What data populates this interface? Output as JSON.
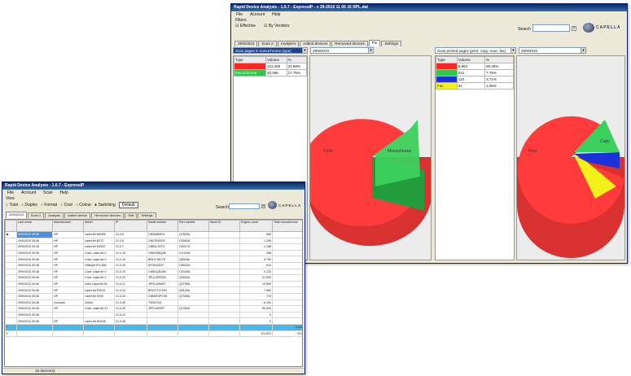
{
  "main_window": {
    "title": "Rapid Device Analysis - 1.0.7 - ExpressIP - v 29-2010 11 06 16 RPL.dat",
    "menu": [
      "File",
      "Account",
      "Help"
    ],
    "filter_label": "Filters",
    "checkboxes": [
      {
        "label": "Effective",
        "checked": true
      },
      {
        "label": "By Vendors",
        "checked": true
      }
    ],
    "search_label": "Search",
    "logo_text": "CAPELLA",
    "tabs": [
      {
        "label": "29/9/2010",
        "active": false
      },
      {
        "label": "Scan 2",
        "active": false
      },
      {
        "label": "Analytics",
        "active": false
      },
      {
        "label": "Added devices",
        "active": false
      },
      {
        "label": "Removed devices",
        "active": false
      },
      {
        "label": "Pie",
        "active": true
      },
      {
        "label": "Settings",
        "active": false
      }
    ],
    "left_chart": {
      "selector_primary": "Scan pages in monochrome (type)",
      "selector_secondary": "29/9/2010",
      "legend_header": [
        "Type",
        "Volume",
        "%"
      ],
      "legend_rows": [
        {
          "type": "Color",
          "volume": "101,280",
          "percent": "22.88%",
          "color": "#ff2626"
        },
        {
          "type": "Monochrome",
          "volume": "20,495",
          "percent": "17.76%",
          "color": "#2ec84a"
        }
      ],
      "pie_labels": [
        "Color",
        "Monochrome"
      ]
    },
    "right_chart": {
      "selector_primary": "Scan printed pages (print, copy, scan, fax)",
      "selector_secondary": "29/9/2010",
      "legend_header": [
        "Type",
        "Volume",
        "%"
      ],
      "legend_rows": [
        {
          "type": "Print",
          "volume": "5,963",
          "percent": "80.49%",
          "color": "#ff2626"
        },
        {
          "type": "Copy",
          "volume": "241",
          "percent": "7.75%",
          "color": "#2ec84a"
        },
        {
          "type": "Scan",
          "volume": "110",
          "percent": "3.71%",
          "color": "#1a32d8"
        },
        {
          "type": "Fax",
          "volume": "31",
          "percent": "1.05%",
          "color": "#f2f21a"
        }
      ],
      "pie_labels": [
        "Print",
        "Copy"
      ]
    }
  },
  "secondary_window": {
    "title": "Rapid Device Analysis - 1.0.7 - ExpressIP",
    "menu": [
      "File",
      "Account",
      "Scan",
      "Help"
    ],
    "view_label": "View",
    "radios": [
      {
        "label": "Total",
        "checked": false
      },
      {
        "label": "Duplex",
        "checked": false
      },
      {
        "label": "Format",
        "checked": false
      },
      {
        "label": "Cost",
        "checked": false
      },
      {
        "label": "Colour",
        "checked": false
      },
      {
        "label": "Switching",
        "checked": true
      }
    ],
    "default_button": "Default",
    "search_label": "Search",
    "logo_text": "CAPELLA",
    "tabs": [
      {
        "label": "29/9/2010",
        "active": true
      },
      {
        "label": "Scan 2",
        "active": false
      },
      {
        "label": "Analysis",
        "active": false
      },
      {
        "label": "Added device",
        "active": false
      },
      {
        "label": "Removed devices",
        "active": false
      },
      {
        "label": "Stat",
        "active": false
      },
      {
        "label": "Settings",
        "active": false
      }
    ],
    "grid_columns": [
      "",
      "Last check",
      "Manufacturer",
      "Model",
      "IP",
      "Serial number",
      "Part number",
      "Asset ID",
      "Engine count",
      "Total monochrome"
    ],
    "grid_rows": [
      [
        "▶",
        "29/9/2010 09:36",
        "HP",
        "LaserJet M9050",
        "21.0.6",
        "CN08383KH",
        "Q7829A",
        "",
        "980",
        ""
      ],
      [
        "",
        "29/9/2010 09:36",
        "HP",
        "LaserJet M727",
        "21.0.8",
        "CN07B4VDF",
        "CE992A",
        "",
        "1,196",
        ""
      ],
      [
        "",
        "29/9/2010 09:36",
        "HP",
        "LaserJet M3027",
        "21.0.7",
        "CNBJL33TO",
        "CB417A",
        "",
        "1,188",
        ""
      ],
      [
        "",
        "29/9/2010 09:36",
        "HP",
        "Color LaserJet C",
        "21.0.15",
        "CNB1M6Q3B",
        "CC419A",
        "",
        "256",
        ""
      ],
      [
        "",
        "29/9/2010 09:36",
        "HP",
        "Color LaserJet C",
        "21.0.16",
        "BROY15D7D",
        "Q5915A",
        "",
        "5,750",
        ""
      ],
      [
        "",
        "29/9/2010 09:36",
        "HP",
        "Officejet Pro 850",
        "21.0.19",
        "MY9A3211F",
        "CB023A",
        "",
        "614",
        ""
      ],
      [
        "",
        "29/9/2010 09:36",
        "HP",
        "Color LaserJet C",
        "21.0.15",
        "CNB1Q3D4N",
        "CE025A",
        "",
        "3,120",
        ""
      ],
      [
        "",
        "29/9/2010 09:36",
        "HP",
        "Color LaserJet C",
        "21.0.23",
        "JPDL30FD8V",
        "Q3932A",
        "",
        "31,000",
        ""
      ],
      [
        "",
        "29/9/2010 09:36",
        "HP",
        "color LaserJet 9k",
        "21.0.21",
        "JPRL30H667",
        "Q3796A",
        "",
        "10,980",
        ""
      ],
      [
        "",
        "29/9/2010 09:36",
        "HP",
        "LaserJet P4015",
        "21.0.14",
        "BROY71T19H",
        "Q5140A",
        "",
        "7,980",
        ""
      ],
      [
        "",
        "29/9/2010 09:36",
        "HP",
        "LaserJet 9200",
        "21.0.25",
        "CNB5F0PV3H",
        "Q7545A",
        "",
        "725",
        ""
      ],
      [
        "",
        "29/9/2010 09:36",
        "Lexmark",
        "X940e",
        "21.0.35",
        "79093754",
        "",
        "",
        "6,190",
        ""
      ],
      [
        "",
        "29/9/2010 09:36",
        "HP",
        "Color LaserJet 47",
        "21.0.26",
        "JPPLJ5099T",
        "Q7492A",
        "",
        "59,000",
        ""
      ],
      [
        "",
        "29/9/2010 09:36",
        "",
        "",
        "21.0.12",
        "",
        "",
        "",
        "0",
        ""
      ],
      [
        "",
        "29/9/2010 09:36",
        "HP",
        "LaserJet M4345",
        "21.0.28",
        "",
        "",
        "",
        "0",
        ""
      ]
    ],
    "grid_total_row": [
      "*",
      "",
      "",
      "",
      "",
      "",
      "",
      "",
      "",
      "4,120"
    ],
    "grid_sum_row": [
      "Σ",
      "",
      "",
      "",
      "",
      "",
      "",
      "",
      "121,521",
      "20,6"
    ],
    "status_text": "15 device(s)"
  },
  "colors": {
    "pie_red": "#ff3b3b",
    "pie_green": "#3cd15c",
    "pie_blue": "#1a32d8",
    "pie_yellow": "#f2f21a",
    "selection": "#49b8e8",
    "title_blue": "#0a246a"
  }
}
